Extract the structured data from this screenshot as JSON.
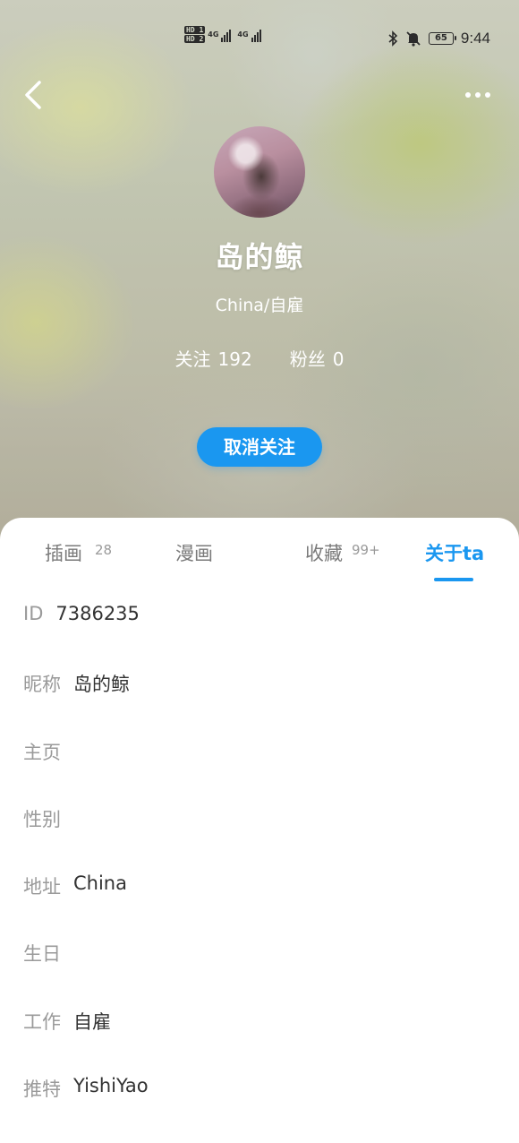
{
  "status_bar": {
    "hd1": "HD 1",
    "hd2": "HD 2",
    "net1": "4G",
    "net2": "4G",
    "battery": "65",
    "time": "9:44",
    "icons": [
      "bluetooth-icon",
      "bell-muted-icon",
      "battery-icon"
    ]
  },
  "nav": {
    "back_icon": "chevron-left-icon",
    "more_icon": "more-horizontal-icon"
  },
  "profile": {
    "name": "岛的鲸",
    "subtitle": "China/自雇",
    "following_label": "关注",
    "following_count": "192",
    "fans_label": "粉丝",
    "fans_count": "0",
    "unfollow_label": "取消关注"
  },
  "tabs": [
    {
      "label": "插画",
      "count": "28"
    },
    {
      "label": "漫画",
      "count": ""
    },
    {
      "label": "收藏",
      "count": "99+"
    },
    {
      "label": "关于ta",
      "count": "",
      "active": true
    }
  ],
  "about": [
    {
      "key": "ID",
      "value": "7386235"
    },
    {
      "key": "昵称",
      "value": "岛的鲸"
    },
    {
      "key": "主页",
      "value": ""
    },
    {
      "key": "性别",
      "value": ""
    },
    {
      "key": "地址",
      "value": "China"
    },
    {
      "key": "生日",
      "value": ""
    },
    {
      "key": "工作",
      "value": "自雇"
    },
    {
      "key": "推特",
      "value": "YishiYao"
    }
  ],
  "colors": {
    "accent": "#1a97f0",
    "label": "#9a9a9a",
    "value": "#333333"
  }
}
